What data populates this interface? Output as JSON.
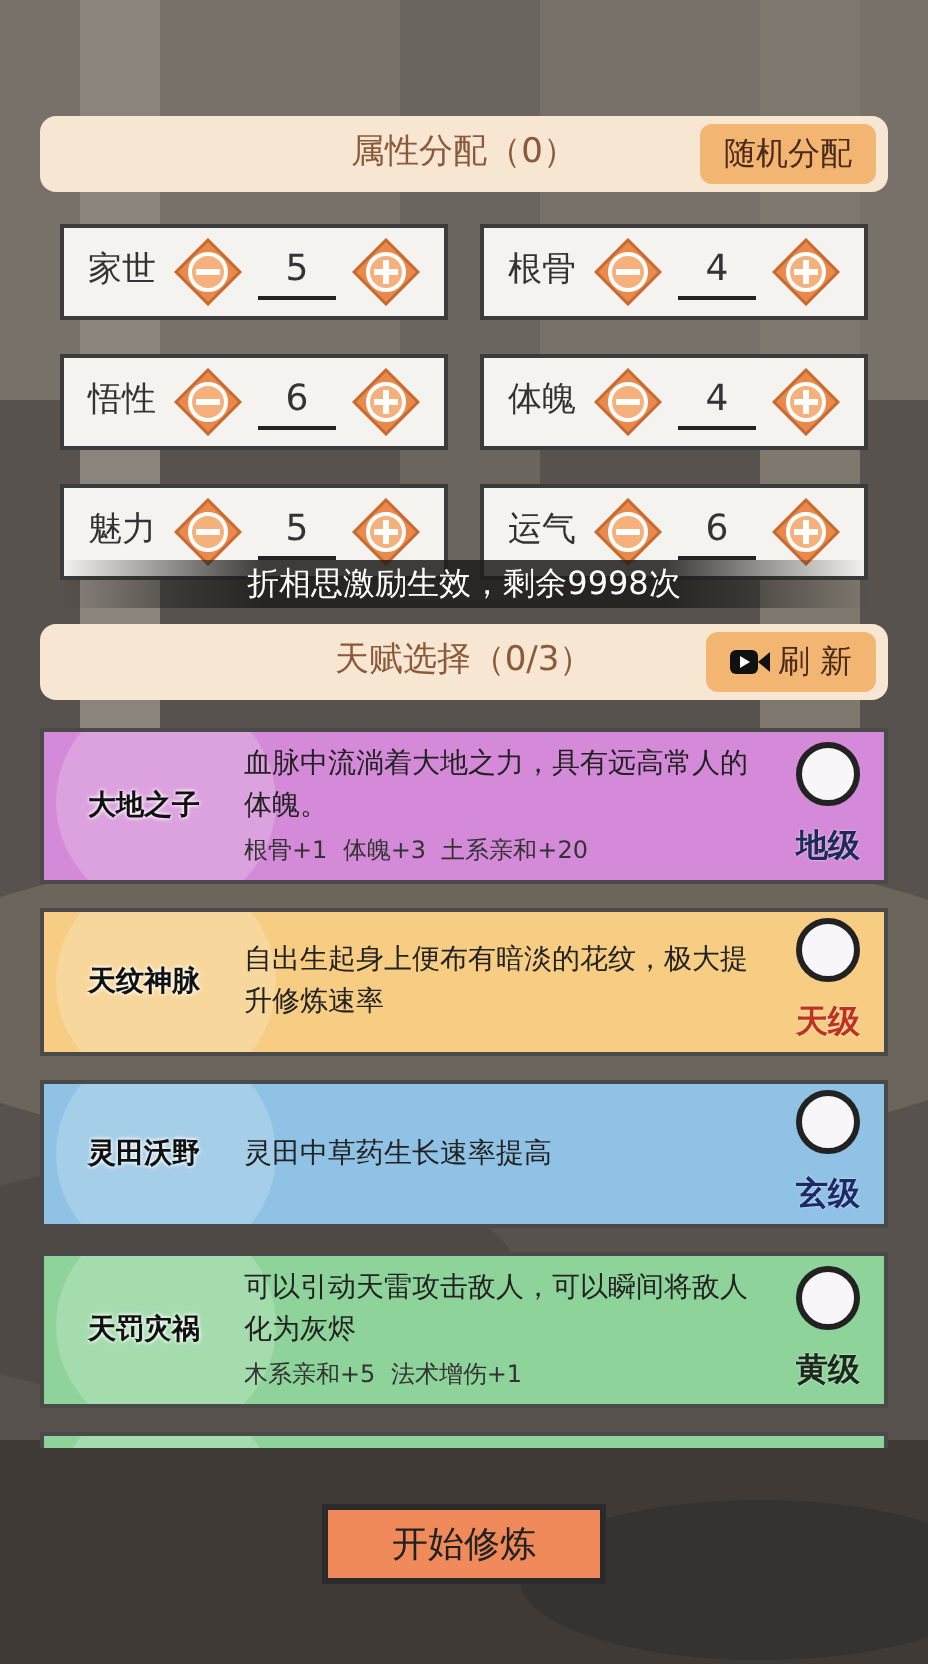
{
  "attributes_header": {
    "title": "属性分配（0）",
    "random_button": "随机分配"
  },
  "attributes": [
    {
      "name": "家世",
      "value": "5"
    },
    {
      "name": "根骨",
      "value": "4"
    },
    {
      "name": "悟性",
      "value": "6"
    },
    {
      "name": "体魄",
      "value": "4"
    },
    {
      "name": "魅力",
      "value": "5"
    },
    {
      "name": "运气",
      "value": "6"
    }
  ],
  "toast": "折相思激励生效，剩余9998次",
  "talents_header": {
    "title": "天赋选择（0/3）",
    "refresh_button": "刷 新"
  },
  "talents": [
    {
      "name": "大地之子",
      "description": "血脉中流淌着大地之力，具有远高常人的体魄。",
      "bonus": "根骨+1  体魄+3  土系亲和+20",
      "grade": "地级",
      "kind": "earth",
      "color": "#d48ad8",
      "selected": false
    },
    {
      "name": "天纹神脉",
      "description": "自出生起身上便布有暗淡的花纹，极大提升修炼速率",
      "grade": "天级",
      "kind": "heaven",
      "color": "#f7cd84",
      "selected": false
    },
    {
      "name": "灵田沃野",
      "description": "灵田中草药生长速率提高",
      "grade": "玄级",
      "kind": "mystic",
      "color": "#8fc2e4",
      "selected": false
    },
    {
      "name": "天罚灾祸",
      "description": "可以引动天雷攻击敌人，可以瞬间将敌人化为灰烬",
      "bonus": "木系亲和+5  法术增伤+1",
      "grade": "黄级",
      "kind": "yellow",
      "color": "#8ed49a",
      "selected": false
    },
    {
      "color": "#8ed49a"
    }
  ],
  "start_button": "开始修炼"
}
